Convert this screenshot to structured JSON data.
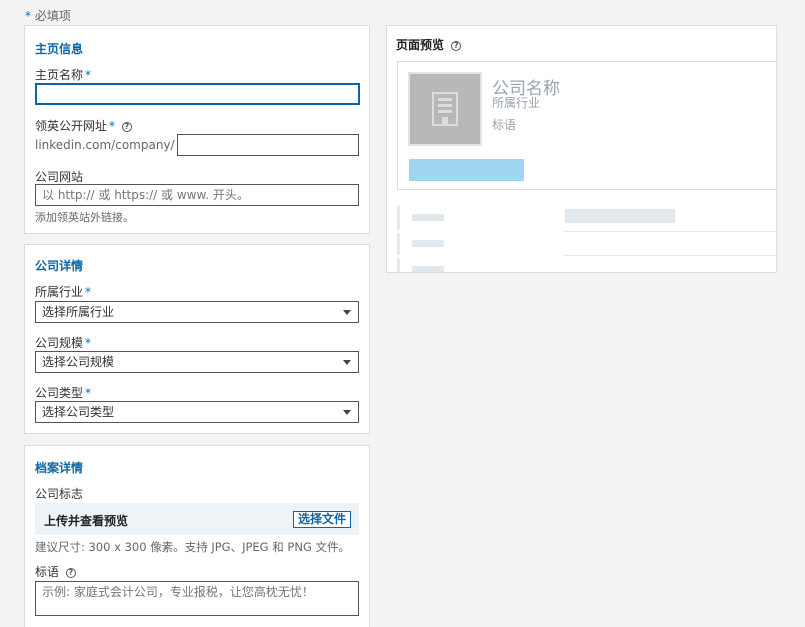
{
  "required_note": {
    "star": "*",
    "text": "必填项"
  },
  "page_info": {
    "title": "主页信息",
    "name_label": "主页名称",
    "name_value": "",
    "url_label": "领英公开网址",
    "url_prefix": "linkedin.com/company/",
    "url_value": "",
    "website_label": "公司网站",
    "website_placeholder": "以 http:// 或 https:// 或 www. 开头。",
    "website_hint": "添加领英站外链接。"
  },
  "company_details": {
    "title": "公司详情",
    "industry_label": "所属行业",
    "industry_value": "选择所属行业",
    "size_label": "公司规模",
    "size_value": "选择公司规模",
    "type_label": "公司类型",
    "type_value": "选择公司类型"
  },
  "profile_details": {
    "title": "档案详情",
    "logo_label": "公司标志",
    "upload_label": "上传并查看预览",
    "choose_file": "选择文件",
    "logo_hint": "建议尺寸: 300 x 300 像素。支持 JPG、JPEG 和 PNG 文件。",
    "tagline_label": "标语",
    "tagline_placeholder": "示例: 家庭式会计公司，专业报税，让您高枕无忧！"
  },
  "preview": {
    "title": "页面预览",
    "company_name": "公司名称",
    "industry": "所属行业",
    "tagline": "标语",
    "button_color": "#9fd6f0"
  },
  "icons": {
    "help": "help-circle-icon",
    "logo_placeholder": "building-icon"
  },
  "star": "*"
}
